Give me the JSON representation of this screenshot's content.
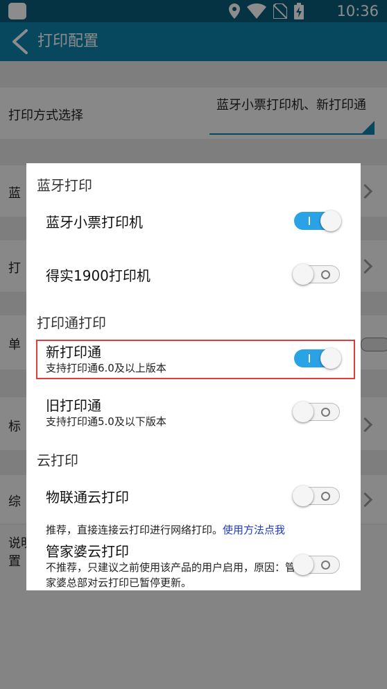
{
  "status_bar": {
    "time": "10:36"
  },
  "app_bar": {
    "title": "打印配置"
  },
  "background": {
    "print_method_label": "打印方式选择",
    "print_method_value": "蓝牙小票打印机、新打印通",
    "row_labels": [
      "蓝",
      "打",
      "单",
      "标",
      "综"
    ],
    "note": "说明",
    "note_tail": "置"
  },
  "dialog": {
    "sections": {
      "bluetooth": "蓝牙打印",
      "print_tong": "打印通打印",
      "cloud": "云打印"
    },
    "items": [
      {
        "title": "蓝牙小票打印机",
        "subtitle": "",
        "enabled": true
      },
      {
        "title": "得实1900打印机",
        "subtitle": "",
        "enabled": false
      },
      {
        "title": "新打印通",
        "subtitle": "支持打印通6.0及以上版本",
        "enabled": true
      },
      {
        "title": "旧打印通",
        "subtitle": "支持打印通5.0及以下版本",
        "enabled": false
      },
      {
        "title": "物联通云打印",
        "subtitle": "推荐，直接连接云打印进行网络打印。",
        "link": "使用方法点我",
        "enabled": false
      },
      {
        "title": "管家婆云打印",
        "subtitle": "不推荐，只建议之前使用该产品的用户启用，原因：管家婆总部对云打印已暂停更新。",
        "enabled": false
      }
    ]
  },
  "colors": {
    "status_bar": "#0a5d7b",
    "app_bar": "#0d83ad",
    "toggle_on": "#29a3e6",
    "highlight": "#e03c3c",
    "link": "#1e3cc8"
  },
  "icons": [
    "app-icon",
    "location-icon",
    "wifi-icon",
    "no-sim-icon",
    "battery-charging-icon",
    "back-arrow-icon",
    "chevron-right-icon"
  ]
}
